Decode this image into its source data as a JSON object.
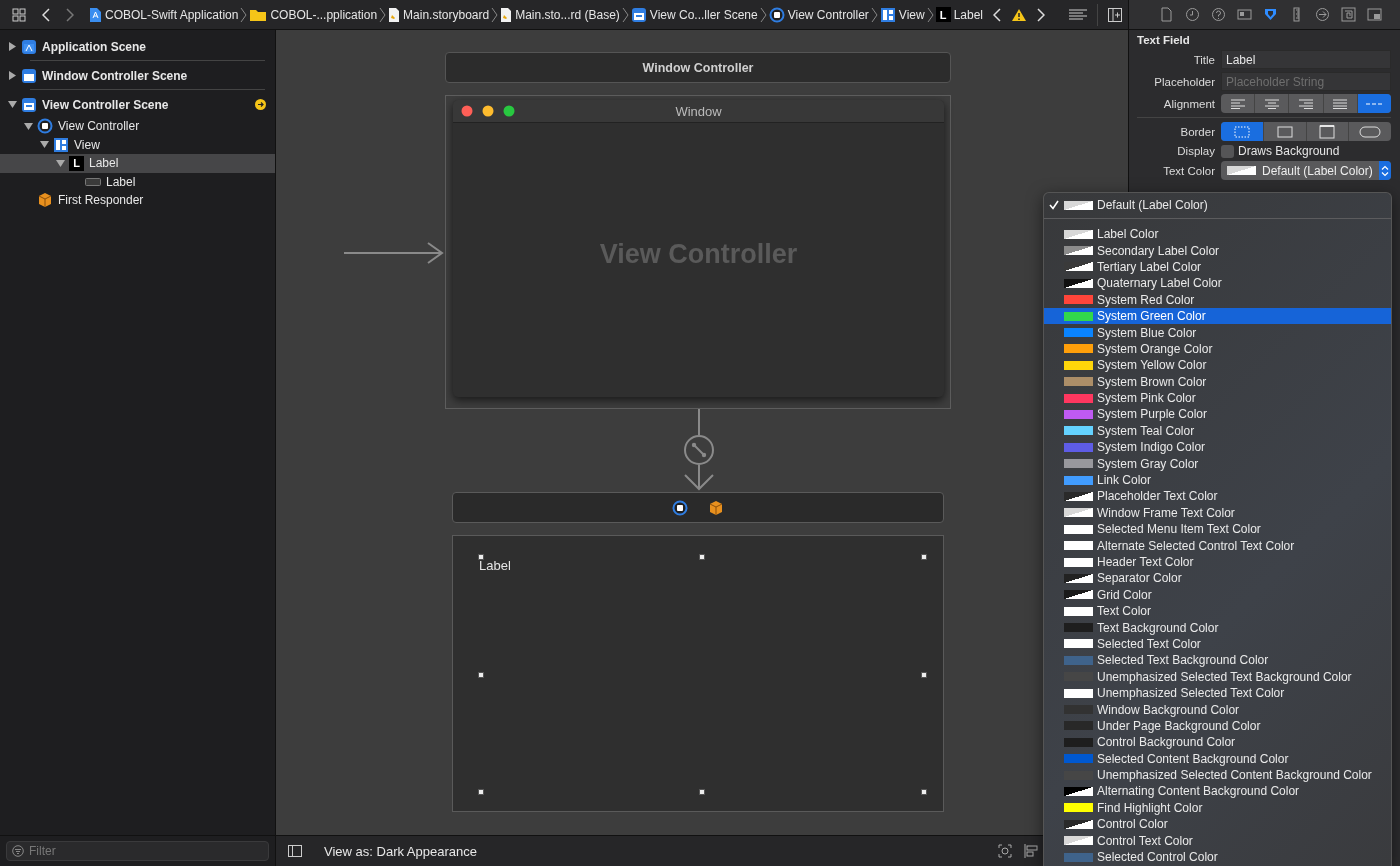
{
  "toolbar": {
    "breadcrumbs": [
      {
        "label": "COBOL-Swift Application",
        "kind": "app"
      },
      {
        "label": "COBOL-...pplication",
        "kind": "folder"
      },
      {
        "label": "Main.storyboard",
        "kind": "storyboard"
      },
      {
        "label": "Main.sto...rd (Base)",
        "kind": "storyboard"
      },
      {
        "label": "View Co...ller Scene",
        "kind": "scene"
      },
      {
        "label": "View Controller",
        "kind": "controller"
      },
      {
        "label": "View",
        "kind": "view"
      },
      {
        "label": "Label",
        "kind": "label",
        "icon_text": "L"
      }
    ]
  },
  "inspector_tabs": [
    {
      "kind": "file",
      "selected": false
    },
    {
      "kind": "history",
      "selected": false
    },
    {
      "kind": "help",
      "selected": false
    },
    {
      "kind": "identity",
      "selected": false
    },
    {
      "kind": "attributes",
      "selected": true
    },
    {
      "kind": "size",
      "selected": false
    },
    {
      "kind": "connections",
      "selected": false
    },
    {
      "kind": "bindings",
      "selected": false
    },
    {
      "kind": "effects",
      "selected": false
    }
  ],
  "navigator": {
    "tree": [
      {
        "label": "Application Scene",
        "kind": "app-scene",
        "expanded": false,
        "selected": false
      },
      {
        "label": "Window Controller Scene",
        "kind": "window-scene",
        "expanded": false,
        "selected": false
      },
      {
        "label": "View Controller Scene",
        "kind": "scene",
        "expanded": true,
        "selected": false,
        "has_issue": true,
        "children": [
          {
            "label": "View Controller",
            "kind": "controller",
            "expanded": true,
            "selected": false,
            "children": [
              {
                "label": "View",
                "kind": "view",
                "expanded": true,
                "selected": false,
                "children": [
                  {
                    "label": "Label",
                    "kind": "label",
                    "icon_text": "L",
                    "expanded": true,
                    "selected": true,
                    "children": [
                      {
                        "label": "Label",
                        "kind": "textfield",
                        "selected": false
                      }
                    ]
                  }
                ]
              }
            ]
          },
          {
            "label": "First Responder",
            "kind": "responder",
            "selected": false
          }
        ]
      }
    ],
    "filter": {
      "placeholder": "Filter"
    }
  },
  "canvas": {
    "window_controller": {
      "title": "Window Controller"
    },
    "window": {
      "title": "Window",
      "content": "View Controller"
    },
    "view": {
      "label": "Label"
    },
    "bottom_bar": {
      "text": "View as: Dark Appearance"
    }
  },
  "inspector": {
    "section": "Text Field",
    "title": {
      "label": "Title",
      "value": "Label"
    },
    "placeholder": {
      "label": "Placeholder",
      "placeholder": "Placeholder String"
    },
    "alignment": {
      "label": "Alignment",
      "segments": [
        {
          "kind": "left",
          "selected": false
        },
        {
          "kind": "center",
          "selected": false
        },
        {
          "kind": "right",
          "selected": false
        },
        {
          "kind": "justified",
          "selected": false
        },
        {
          "kind": "natural",
          "selected": true
        }
      ]
    },
    "border": {
      "label": "Border",
      "segments": [
        {
          "kind": "none",
          "selected": true
        },
        {
          "kind": "line",
          "selected": false
        },
        {
          "kind": "bezel",
          "selected": false
        },
        {
          "kind": "rounded",
          "selected": false
        }
      ]
    },
    "display": {
      "label": "Display",
      "checkbox": "Draws Background",
      "checked": false
    },
    "text_color": {
      "label": "Text Color",
      "value": "Default (Label Color)",
      "kind": "dynamic",
      "color": "#d8d8d8"
    }
  },
  "color_menu": {
    "current": {
      "label": "Default (Label Color)",
      "checked": true,
      "kind": "dynamic",
      "color": "#d8d8d8"
    },
    "items": [
      {
        "label": "Label Color",
        "kind": "dynamic",
        "color": "#d8d8d8",
        "selected": false
      },
      {
        "label": "Secondary Label Color",
        "kind": "dynamic",
        "color": "#8c8c8c",
        "selected": false
      },
      {
        "label": "Tertiary Label Color",
        "kind": "dynamic",
        "color": "#3a3a3a",
        "selected": false
      },
      {
        "label": "Quaternary Label Color",
        "kind": "dynamic",
        "color": "#111111",
        "selected": false
      },
      {
        "label": "System Red Color",
        "kind": "solid",
        "color": "#ff453a",
        "selected": false
      },
      {
        "label": "System Green Color",
        "kind": "solid",
        "color": "#32d74b",
        "selected": true
      },
      {
        "label": "System Blue Color",
        "kind": "solid",
        "color": "#0a84ff",
        "selected": false
      },
      {
        "label": "System Orange Color",
        "kind": "solid",
        "color": "#ff9f0a",
        "selected": false
      },
      {
        "label": "System Yellow Color",
        "kind": "solid",
        "color": "#ffd60a",
        "selected": false
      },
      {
        "label": "System Brown Color",
        "kind": "solid",
        "color": "#ac8e68",
        "selected": false
      },
      {
        "label": "System Pink Color",
        "kind": "solid",
        "color": "#ff375f",
        "selected": false
      },
      {
        "label": "System Purple Color",
        "kind": "solid",
        "color": "#bf5af2",
        "selected": false
      },
      {
        "label": "System Teal Color",
        "kind": "solid",
        "color": "#64d2ff",
        "selected": false
      },
      {
        "label": "System Indigo Color",
        "kind": "solid",
        "color": "#5e5ce6",
        "selected": false
      },
      {
        "label": "System Gray Color",
        "kind": "solid",
        "color": "#98989d",
        "selected": false
      },
      {
        "label": "Link Color",
        "kind": "solid",
        "color": "#419cff",
        "selected": false
      },
      {
        "label": "Placeholder Text Color",
        "kind": "dynamic",
        "color": "#2a2a2a",
        "selected": false
      },
      {
        "label": "Window Frame Text Color",
        "kind": "dynamic",
        "color": "#d8d8d8",
        "selected": false
      },
      {
        "label": "Selected Menu Item Text Color",
        "kind": "solid",
        "color": "#ffffff",
        "selected": false
      },
      {
        "label": "Alternate Selected Control Text Color",
        "kind": "solid",
        "color": "#ffffff",
        "selected": false
      },
      {
        "label": "Header Text Color",
        "kind": "solid",
        "color": "#ffffff",
        "selected": false
      },
      {
        "label": "Separator Color",
        "kind": "dynamic",
        "color": "#222222",
        "selected": false
      },
      {
        "label": "Grid Color",
        "kind": "dynamic",
        "color": "#1a1a1a",
        "selected": false
      },
      {
        "label": "Text Color",
        "kind": "solid",
        "color": "#ffffff",
        "selected": false
      },
      {
        "label": "Text Background Color",
        "kind": "solid",
        "color": "#1e1e1e",
        "selected": false
      },
      {
        "label": "Selected Text Color",
        "kind": "solid",
        "color": "#ffffff",
        "selected": false
      },
      {
        "label": "Selected Text Background Color",
        "kind": "solid",
        "color": "#3f638b",
        "selected": false
      },
      {
        "label": "Unemphasized Selected Text Background Color",
        "kind": "solid",
        "color": "#464646",
        "selected": false
      },
      {
        "label": "Unemphasized Selected Text Color",
        "kind": "solid",
        "color": "#ffffff",
        "selected": false
      },
      {
        "label": "Window Background Color",
        "kind": "solid",
        "color": "#323232",
        "selected": false
      },
      {
        "label": "Under Page Background Color",
        "kind": "solid",
        "color": "#282828",
        "selected": false
      },
      {
        "label": "Control Background Color",
        "kind": "solid",
        "color": "#1e1e1e",
        "selected": false
      },
      {
        "label": "Selected Content Background Color",
        "kind": "solid",
        "color": "#0058d0",
        "selected": false
      },
      {
        "label": "Unemphasized Selected Content Background Color",
        "kind": "solid",
        "color": "#464646",
        "selected": false
      },
      {
        "label": "Alternating Content Background Color",
        "kind": "dynamic",
        "color": "#000000",
        "selected": false
      },
      {
        "label": "Find Highlight Color",
        "kind": "solid",
        "color": "#ffff00",
        "selected": false
      },
      {
        "label": "Control Color",
        "kind": "dynamic",
        "color": "#2a2a2a",
        "selected": false
      },
      {
        "label": "Control Text Color",
        "kind": "dynamic",
        "color": "#d8d8d8",
        "selected": false
      },
      {
        "label": "Selected Control Color",
        "kind": "solid",
        "color": "#3f638b",
        "selected": false
      }
    ]
  }
}
